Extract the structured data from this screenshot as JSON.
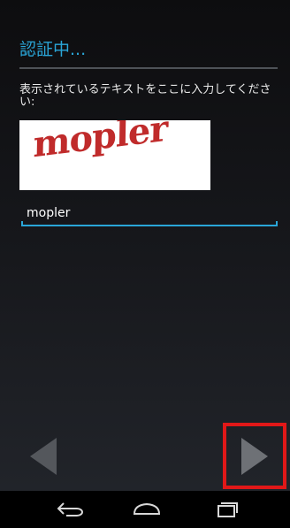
{
  "title": "認証中...",
  "instruction": "表示されているテキストをここに入力してください:",
  "captcha": {
    "text": "mopler"
  },
  "input": {
    "value": "mopler",
    "placeholder": ""
  },
  "nav": {
    "back_icon": "left-arrow-icon",
    "next_icon": "right-arrow-icon"
  },
  "system_nav": {
    "back_icon": "back-icon",
    "home_icon": "home-icon",
    "recent_icon": "recent-apps-icon"
  },
  "colors": {
    "accent": "#2aa6d8",
    "highlight": "#e11818",
    "captcha_text": "#c02b2b"
  }
}
